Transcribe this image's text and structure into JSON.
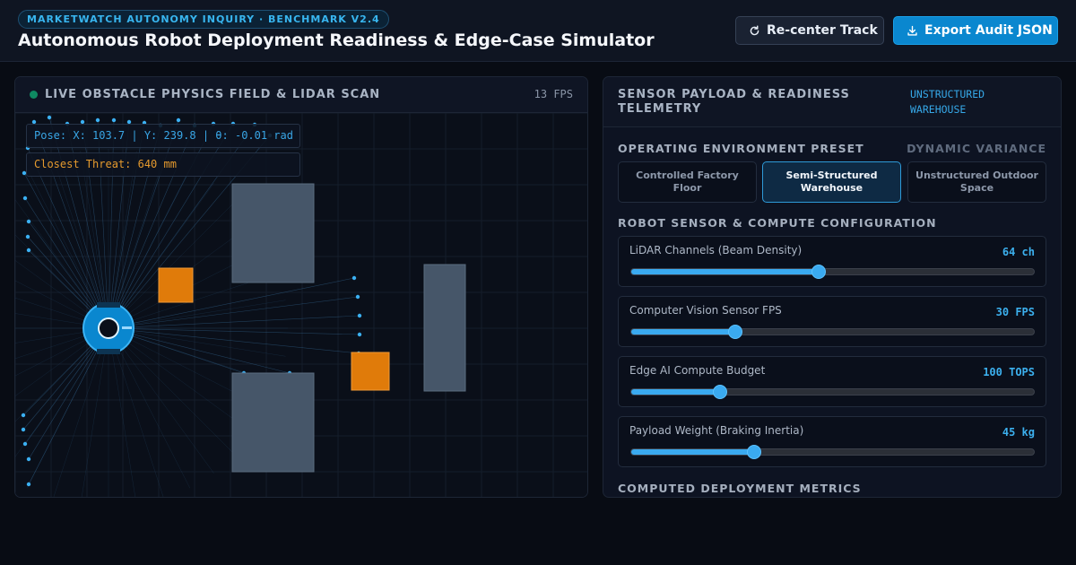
{
  "header": {
    "badge": "MARKETWATCH AUTONOMY INQUIRY · BENCHMARK V2.4",
    "title": "Autonomous Robot Deployment Readiness & Edge-Case Simulator",
    "recenter_label": "Re-center Track",
    "export_label": "Export Audit JSON"
  },
  "physics": {
    "title": "LIVE OBSTACLE PHYSICS FIELD & LIDAR SCAN",
    "fps": "13 FPS",
    "pose": "Pose: X: 103.7 | Y: 239.8 | θ: -0.01 rad",
    "threat": "Closest Threat: 640 mm"
  },
  "telemetry": {
    "title": "SENSOR PAYLOAD & READINESS TELEMETRY",
    "environment_tag": "UNSTRUCTURED WAREHOUSE",
    "preset_label": "OPERATING ENVIRONMENT PRESET",
    "variance_label": "DYNAMIC VARIANCE",
    "presets": [
      {
        "label": "Controlled Factory Floor",
        "active": false
      },
      {
        "label": "Semi-Structured Warehouse",
        "active": true
      },
      {
        "label": "Unstructured Outdoor Space",
        "active": false
      }
    ],
    "config_label": "ROBOT SENSOR & COMPUTE CONFIGURATION",
    "sliders": [
      {
        "label": "LiDAR Channels (Beam Density)",
        "value": "64 ch",
        "fraction": 0.465
      },
      {
        "label": "Computer Vision Sensor FPS",
        "value": "30 FPS",
        "fraction": 0.258
      },
      {
        "label": "Edge AI Compute Budget",
        "value": "100 TOPS",
        "fraction": 0.22
      },
      {
        "label": "Payload Weight (Braking Inertia)",
        "value": "45 kg",
        "fraction": 0.306
      }
    ],
    "metrics_label": "COMPUTED DEPLOYMENT METRICS"
  },
  "colors": {
    "accent": "#3aaaf0",
    "obstacle_static": "#465669",
    "obstacle_dynamic": "#e07b0a",
    "robot": "#0a87cf"
  }
}
